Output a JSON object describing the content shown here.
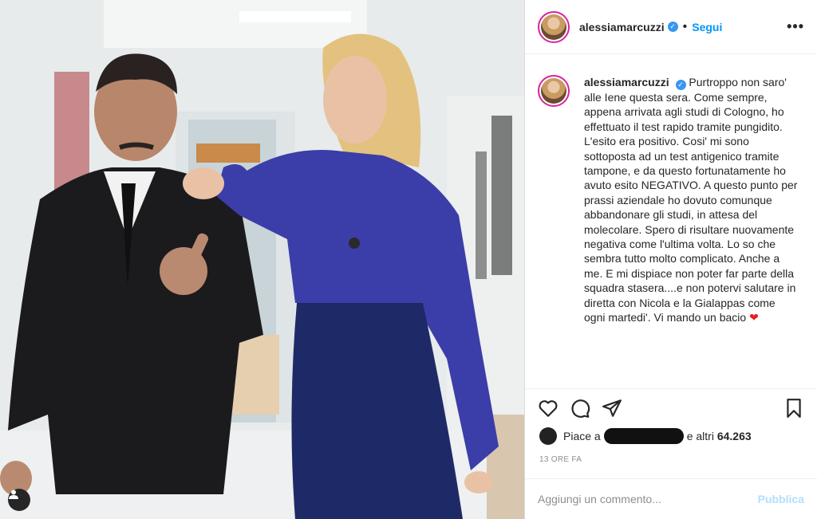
{
  "post": {
    "username": "alessiamarcuzzi",
    "follow_label": "Segui",
    "dot": "•",
    "more_label": "•••",
    "verified_glyph": "✓",
    "caption": "Purtroppo non saro' alle Iene questa sera. Come sempre, appena arrivata agli studi di Cologno, ho effettuato il test rapido tramite pungidito. L'esito era positivo. Cosi' mi sono sottoposta ad un test antigenico tramite tampone, e da questo fortunatamente ho avuto esito NEGATIVO. A questo punto per prassi aziendale ho dovuto comunque abbandonare gli studi, in attesa del molecolare. Spero di risultare nuovamente negativa come l'ultima volta. Lo so che sembra tutto molto complicato. Anche a me. E mi dispiace non poter far parte della squadra stasera....e non potervi salutare in diretta con Nicola e la Gialappas come ogni martedi'. Vi mando un bacio",
    "caption_emoji": "❤",
    "likes_prefix": "Piace a",
    "likes_suffix": "e altri",
    "likes_count": "64.263",
    "timestamp": "13 ORE FA",
    "comment_placeholder": "Aggiungi un commento...",
    "publish_label": "Pubblica"
  },
  "icons": {
    "like": "heart-outline-icon",
    "comment": "comment-bubble-icon",
    "share": "paper-plane-icon",
    "save": "bookmark-icon",
    "user_tag": "user-tag-icon"
  }
}
